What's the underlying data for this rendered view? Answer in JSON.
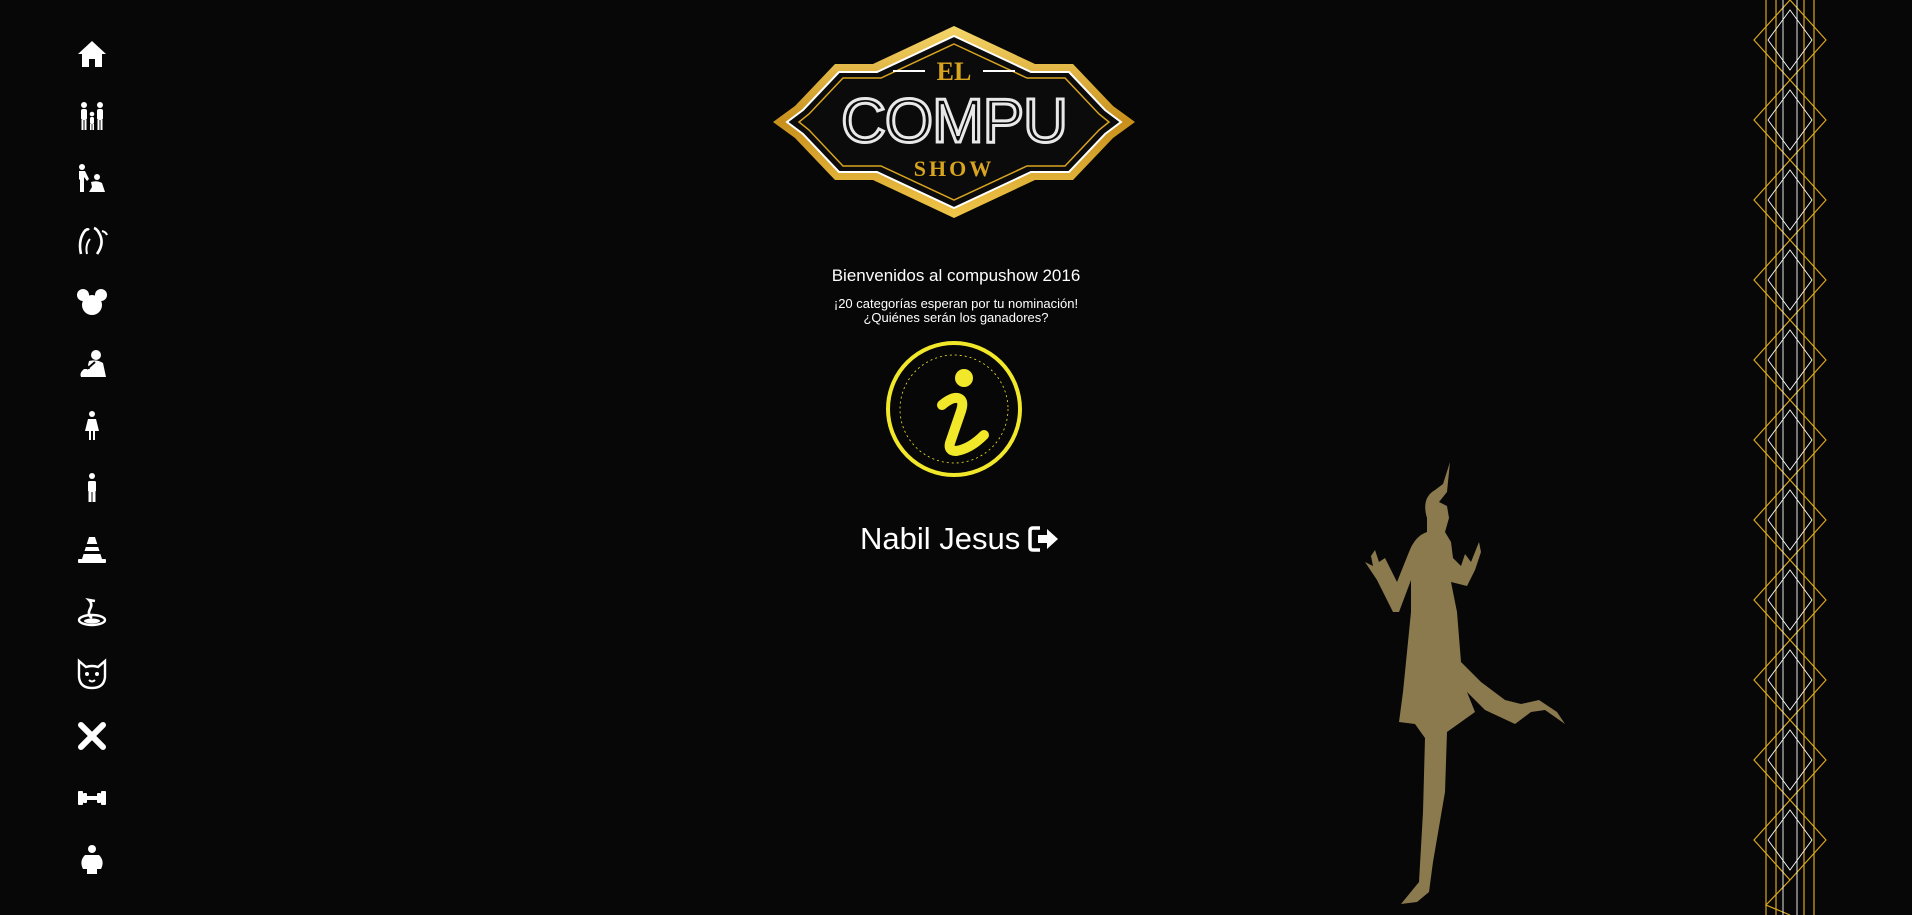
{
  "welcome": {
    "title": "Bienvenidos al compushow 2016",
    "subtitle_line1": "¡20 categorías esperan por tu nominación!",
    "subtitle_line2": "¿Quiénes serán los ganadores?"
  },
  "logo": {
    "top_word": "EL",
    "main_word": "COMPU",
    "bottom_word": "SHOW"
  },
  "user": {
    "name": "Nabil Jesus",
    "logout_icon": "sign-out-icon"
  },
  "sidebar": {
    "items": [
      {
        "icon": "home-icon"
      },
      {
        "icon": "family-icon"
      },
      {
        "icon": "couple-kneeling-icon"
      },
      {
        "icon": "horns-icon"
      },
      {
        "icon": "mouse-ears-icon"
      },
      {
        "icon": "thinking-person-icon"
      },
      {
        "icon": "woman-icon"
      },
      {
        "icon": "man-icon"
      },
      {
        "icon": "traffic-cone-icon"
      },
      {
        "icon": "snake-icon"
      },
      {
        "icon": "cat-face-icon"
      },
      {
        "icon": "close-x-icon"
      },
      {
        "icon": "dumbbell-icon"
      },
      {
        "icon": "chubby-person-icon"
      }
    ]
  },
  "colors": {
    "background": "#070707",
    "gold": "#d9a520",
    "badge_yellow": "#f2e82a",
    "dancer": "#8b7a4e"
  }
}
